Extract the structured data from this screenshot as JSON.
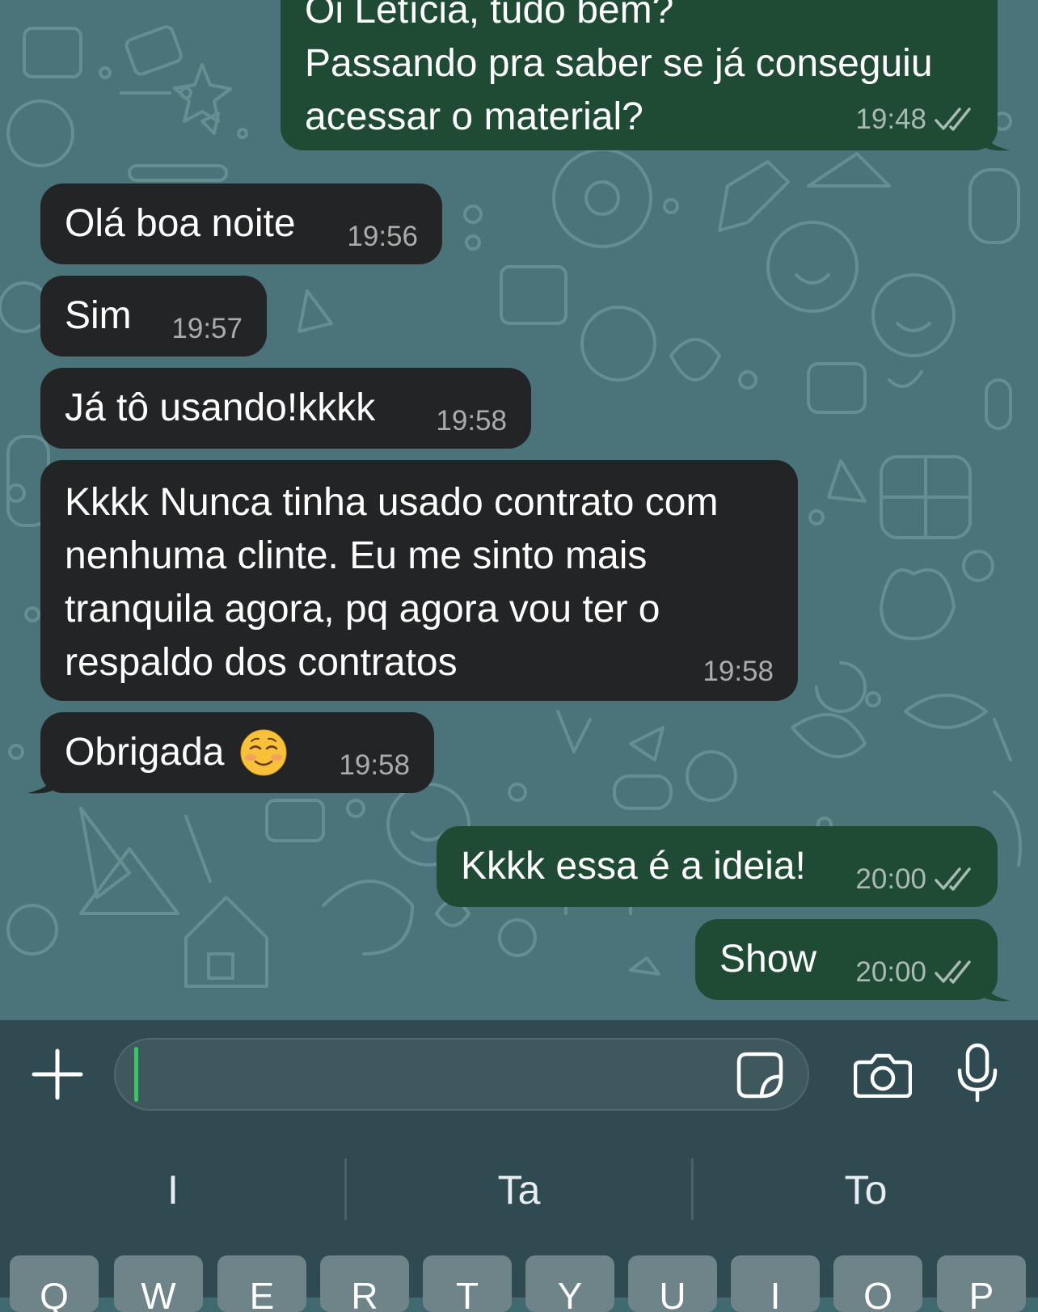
{
  "messages": [
    {
      "id": "m0",
      "direction": "outgoing",
      "text": "Oi Letícia, tudo bem?\nPassando pra saber se já conseguiu\nacessar o material?",
      "time": "19:48",
      "status": "read"
    },
    {
      "id": "m1",
      "direction": "incoming",
      "text": "Olá boa noite",
      "time": "19:56"
    },
    {
      "id": "m2",
      "direction": "incoming",
      "text": "Sim",
      "time": "19:57"
    },
    {
      "id": "m3",
      "direction": "incoming",
      "text": "Já tô usando!kkkk",
      "time": "19:58"
    },
    {
      "id": "m4",
      "direction": "incoming",
      "text": "Kkkk Nunca tinha usado contrato com\nnenhuma clinte. Eu me sinto mais\ntranquila agora, pq agora vou ter o\nrespaldo dos contratos",
      "time": "19:58"
    },
    {
      "id": "m5",
      "direction": "incoming",
      "text": "Obrigada",
      "emoji": "smiling-face-emoji",
      "time": "19:58"
    },
    {
      "id": "m6",
      "direction": "outgoing",
      "text": "Kkkk essa é a ideia!",
      "time": "20:00",
      "status": "read"
    },
    {
      "id": "m7",
      "direction": "outgoing",
      "text": "Show",
      "time": "20:00",
      "status": "read"
    }
  ],
  "composer": {
    "value": "",
    "icons": [
      "plus-icon",
      "sticker-icon",
      "camera-icon",
      "microphone-icon"
    ]
  },
  "keyboard": {
    "suggestions": [
      "I",
      "Ta",
      "To"
    ],
    "top_row_keys": [
      "Q",
      "W",
      "E",
      "R",
      "T",
      "Y",
      "U",
      "I",
      "O",
      "P"
    ]
  },
  "colors": {
    "chat_background": "#4a7479",
    "incoming_bubble": "#232425",
    "outgoing_bubble": "#1f4b34",
    "caret": "#43c06c"
  }
}
